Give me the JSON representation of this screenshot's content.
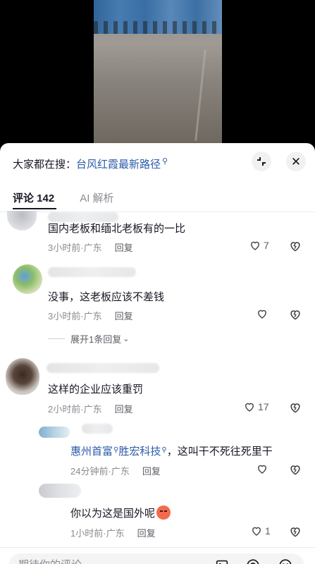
{
  "search": {
    "prefix": "大家都在搜：",
    "query": "台风红霞最新路径",
    "search_icon": "search-icon"
  },
  "tabs": [
    {
      "label": "评论 142",
      "active": true
    },
    {
      "label": "AI 解析",
      "active": false
    }
  ],
  "comments": [
    {
      "text": "国内老板和缅北老板有的一比",
      "time": "3小时前",
      "location": "广东",
      "reply_label": "回复",
      "likes": "7"
    },
    {
      "text": "没事，这老板应该不差钱",
      "time": "3小时前",
      "location": "广东",
      "reply_label": "回复",
      "likes": ""
    },
    {
      "text": "这样的企业应该重罚",
      "time": "2小时前",
      "location": "广东",
      "reply_label": "回复",
      "likes": "17"
    }
  ],
  "expand_replies": "展开1条回复",
  "replies": [
    {
      "links": [
        "惠州首富",
        "胜宏科技"
      ],
      "text": "，这叫干不死往死里干",
      "time": "24分钟前",
      "location": "广东",
      "reply_label": "回复",
      "likes": ""
    },
    {
      "text": "你以为这是国外呢",
      "emoji": "heated-face-emoji",
      "time": "1小时前",
      "location": "广东",
      "reply_label": "回复",
      "likes": "1"
    }
  ],
  "input": {
    "placeholder": "期待你的评论",
    "icons": [
      "image-icon",
      "at-icon",
      "emoji-icon"
    ]
  },
  "colors": {
    "link": "#2b5aa8",
    "muted": "#8a8b91",
    "text": "#161823"
  }
}
